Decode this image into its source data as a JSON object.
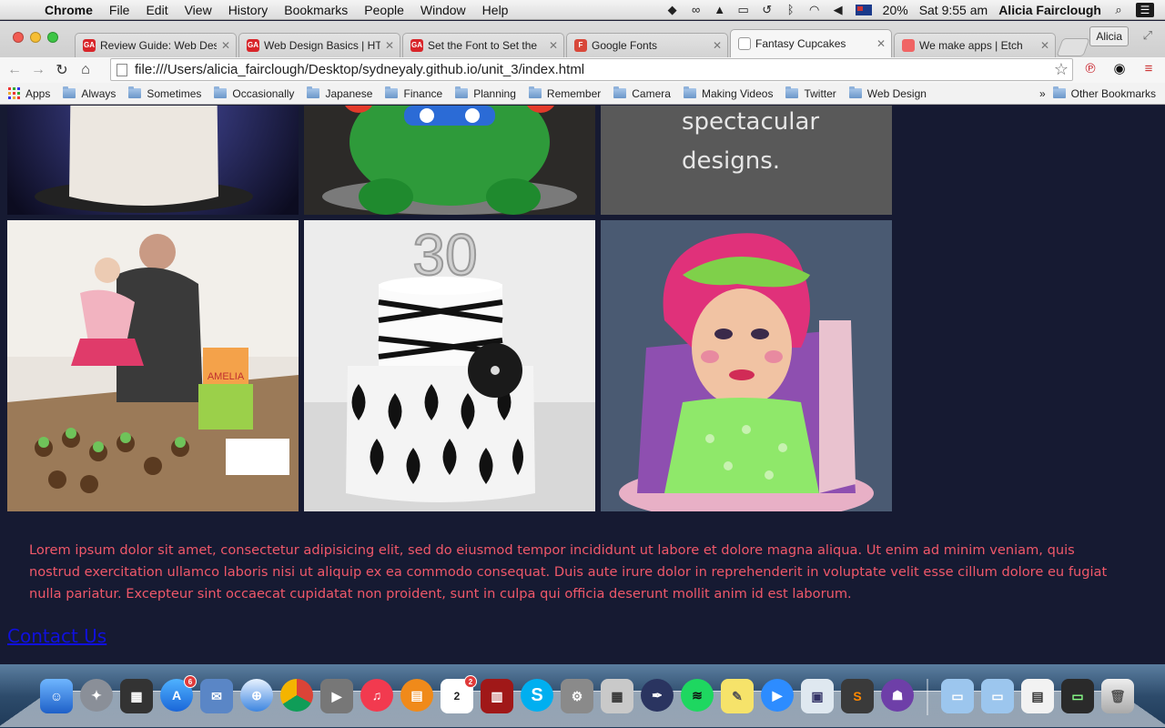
{
  "menubar": {
    "app": "Chrome",
    "items": [
      "File",
      "Edit",
      "View",
      "History",
      "Bookmarks",
      "People",
      "Window",
      "Help"
    ],
    "battery": "20%",
    "clock": "Sat 9:55 am",
    "user": "Alicia Fairclough"
  },
  "tabs": [
    {
      "title": "Review Guide: Web Desi",
      "favicon_color": "#d8252a",
      "favicon_text": "GA"
    },
    {
      "title": "Web Design Basics | HTM",
      "favicon_color": "#d8252a",
      "favicon_text": "GA"
    },
    {
      "title": "Set the Font to Set the",
      "favicon_color": "#d8252a",
      "favicon_text": "GA"
    },
    {
      "title": "Google Fonts",
      "favicon_color": "#d8483a",
      "favicon_text": "F"
    },
    {
      "title": "Fantasy Cupcakes",
      "favicon_color": "#ffffff",
      "favicon_text": ""
    },
    {
      "title": "We make apps | Etch",
      "favicon_color": "#f06464",
      "favicon_text": ""
    }
  ],
  "active_tab_index": 4,
  "profile_button": "Alicia",
  "address": {
    "url": "file:///Users/alicia_fairclough/Desktop/sydneyaly.github.io/unit_3/index.html"
  },
  "bookmarks": {
    "apps_label": "Apps",
    "folders": [
      "Always",
      "Sometimes",
      "Occasionally",
      "Japanese",
      "Finance",
      "Planning",
      "Remember",
      "Camera",
      "Making Videos",
      "Twitter",
      "Web Design"
    ],
    "more": "»",
    "other": "Other Bookmarks"
  },
  "page": {
    "tagline_lines": [
      "spectacular",
      "designs."
    ],
    "paragraph": "Lorem ipsum dolor sit amet, consectetur adipisicing elit, sed do eiusmod tempor incididunt ut labore et dolore magna aliqua. Ut enim ad minim veniam, quis nostrud exercitation ullamco laboris nisi ut aliquip ex ea commodo consequat. Duis aute irure dolor in reprehenderit in voluptate velit esse cillum dolore eu fugiat nulla pariatur. Excepteur sint occaecat cupidatat non proident, sunt in culpa qui officia deserunt mollit anim id est laborum.",
    "contact_link": "Contact Us",
    "cake_topper": "30",
    "banner_name": "AMELIA"
  },
  "dock": {
    "app_store_badge": "6",
    "calendar_badge": "2",
    "calendar_month": "JUL",
    "calendar_day": "2"
  },
  "colors": {
    "page_background": "#161a32",
    "paragraph_text": "#f0586a",
    "link": "#1010dd"
  }
}
